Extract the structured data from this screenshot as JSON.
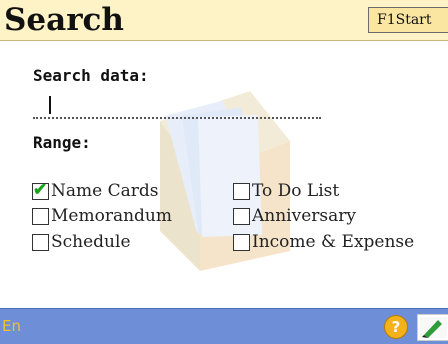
{
  "header": {
    "title": "Search",
    "f1_label": "F1Start"
  },
  "form": {
    "search_label": "Search data:",
    "search_value": "",
    "range_label": "Range:"
  },
  "ranges": {
    "name_cards": {
      "label": "Name Cards",
      "checked": true
    },
    "memorandum": {
      "label": "Memorandum",
      "checked": false
    },
    "schedule": {
      "label": "Schedule",
      "checked": false
    },
    "todo": {
      "label": "To Do List",
      "checked": false
    },
    "anniversary": {
      "label": "Anniversary",
      "checked": false
    },
    "income": {
      "label": "Income & Expense",
      "checked": false
    }
  },
  "status": {
    "lang": "En",
    "help_glyph": "?"
  },
  "colors": {
    "title_bg": "#fdf3c6",
    "status_bg": "#6e8fd7",
    "check": "#19a319",
    "help": "#f3b21a"
  }
}
